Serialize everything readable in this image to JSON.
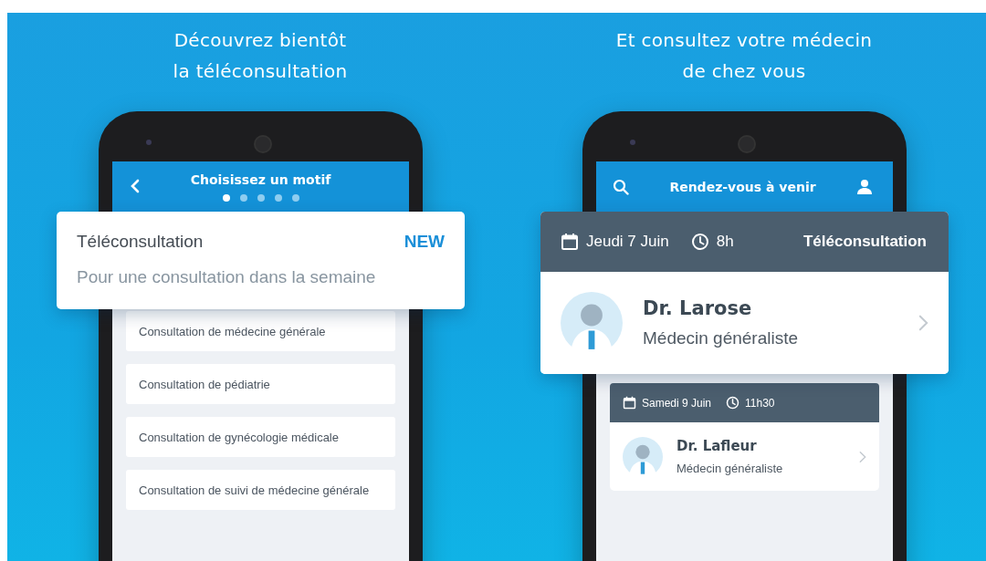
{
  "panels": [
    {
      "kind": "motif",
      "heading": [
        "Découvrez bientôt",
        "la téléconsultation"
      ],
      "screen": {
        "title": "Choisissez un motif",
        "steps": [
          {
            "selected": true
          },
          {
            "selected": false
          },
          {
            "selected": false
          },
          {
            "selected": false
          },
          {
            "selected": false
          }
        ],
        "card": {
          "title": "Téléconsultation",
          "badge": "NEW",
          "subtitle": "Pour une consultation dans la semaine"
        },
        "items": [
          "Consultation de médecine générale",
          "Consultation de pédiatrie",
          "Consultation de gynécologie médicale",
          "Consultation de suivi de médecine générale"
        ]
      }
    },
    {
      "kind": "appointments",
      "heading": [
        "Et consultez votre médecin",
        "de chez vous"
      ],
      "screen": {
        "title": "Rendez-vous à venir",
        "appointments": [
          {
            "date": "Jeudi 7 Juin",
            "time": "8h",
            "type": "Téléconsultation",
            "doctor": "Dr. Larose",
            "specialty": "Médecin généraliste"
          },
          {
            "date": "Samedi 9 Juin",
            "time": "11h30",
            "doctor": "Dr. Lafleur",
            "specialty": "Médecin généraliste"
          }
        ]
      }
    }
  ]
}
